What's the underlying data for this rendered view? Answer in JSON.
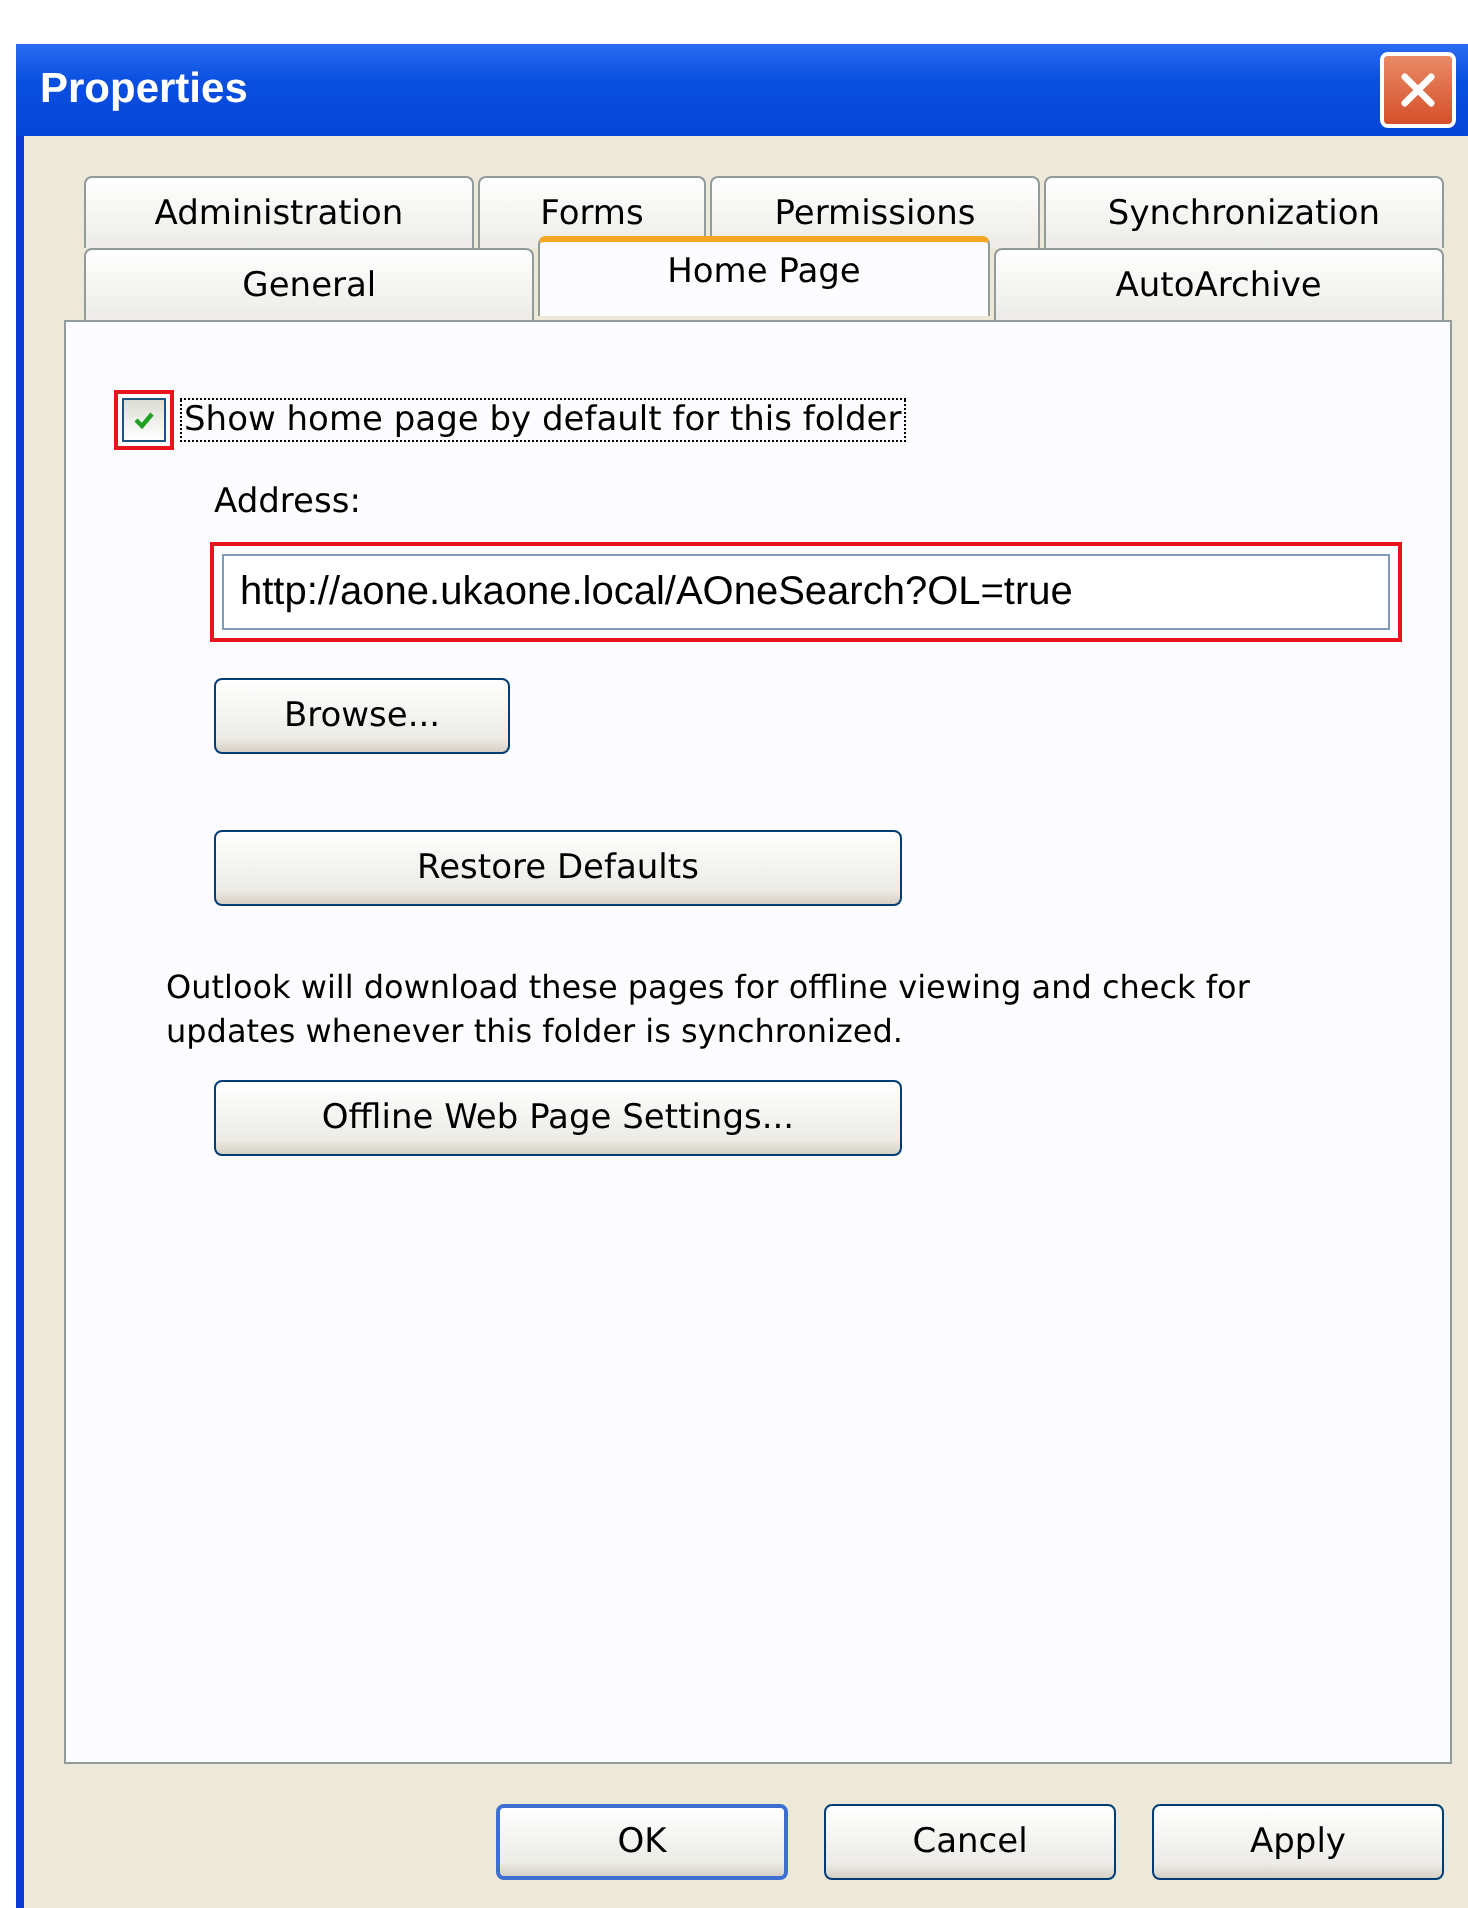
{
  "window": {
    "title": "Properties"
  },
  "tab_rows": [
    [
      {
        "label": "Administration",
        "selected": false
      },
      {
        "label": "Forms",
        "selected": false
      },
      {
        "label": "Permissions",
        "selected": false
      },
      {
        "label": "Synchronization",
        "selected": false
      }
    ],
    [
      {
        "label": "General",
        "selected": false
      },
      {
        "label": "Home Page",
        "selected": true
      },
      {
        "label": "AutoArchive",
        "selected": false
      }
    ]
  ],
  "show_home_page": {
    "label": "Show home page by default for this folder",
    "checked": true,
    "highlighted": true
  },
  "address": {
    "label": "Address:",
    "value": "http://aone.ukaone.local/AOneSearch?OL=true",
    "highlighted": true
  },
  "browse_button": "Browse...",
  "restore_button": "Restore Defaults",
  "info_text": "Outlook will download these pages for offline viewing and check for updates whenever this folder is synchronized.",
  "offline_button": "Offline Web Page Settings...",
  "buttons": [
    {
      "label": "OK",
      "kind": "default"
    },
    {
      "label": "Cancel",
      "kind": "normal"
    },
    {
      "label": "Apply",
      "kind": "normal"
    }
  ]
}
